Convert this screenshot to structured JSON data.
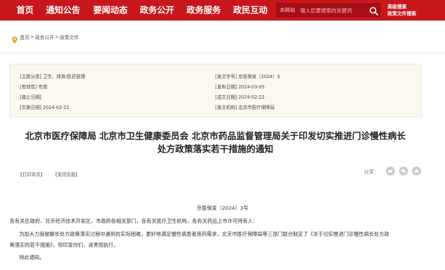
{
  "nav": {
    "items": [
      "首页",
      "通知公告",
      "要闻动态",
      "政务公开",
      "政务服务",
      "政民互动"
    ],
    "search_scope": "本网站",
    "search_placeholder": "输入您要搜索的关键词",
    "search_icon": "search-icon",
    "advanced_search": "高级搜索",
    "policy_search": "政策文件搜索"
  },
  "breadcrumb": {
    "icon": "location-pin-icon",
    "items": [
      "首页",
      "政务公开",
      "政策文件"
    ],
    "separator": ">"
  },
  "meta": {
    "category": "[主题分类] 卫生、体育/医药管理",
    "validity": "[有效性] 有效",
    "abolish_date": "[废止日期]",
    "effective_date": "[实施日期] 2024-02-22",
    "doc_number": "[发文字号] 京医保发〔2024〕3",
    "publish_date": "[发布日期] 2024-03-05",
    "written_date": "[成文日期] 2024-02-22",
    "issuer": "[发文机构] 北京市医疗保障局"
  },
  "title": {
    "line1": "北京市医疗保障局 北京市卫生健康委员会 北京市药品监督管理局关于印发切实推进门诊慢性病长",
    "line2": "处方政策落实若干措施的通知"
  },
  "tools": {
    "print": "【打印本页】",
    "close": "【关闭页面】",
    "share_label": "分享：",
    "share_icons": [
      "weibo-icon",
      "wechat-icon",
      "share-icon"
    ]
  },
  "body": {
    "doc_no": "京医保发〔2024〕3号",
    "recipients": "各有关区政府、北京经济技术开发区，市政府各相关部门，各有关医疗卫生机构，各有关药品上市许可持有人：",
    "p1_line1": "为加大力度破解长处方政策落实过程中遇到的实际困难，更好地满足慢性病患者用药需求，北京市医疗保障局等三部门联合制定了《关于切实推进门诊慢性病长处方政",
    "p1_line2": "策落实的若干措施》，现印发你们，请贯彻执行。",
    "closing": "特此通知。"
  },
  "colors": {
    "nav_bg": "#c8161d",
    "meta_bg": "#fbf8ef",
    "pin": "#f0a020"
  }
}
